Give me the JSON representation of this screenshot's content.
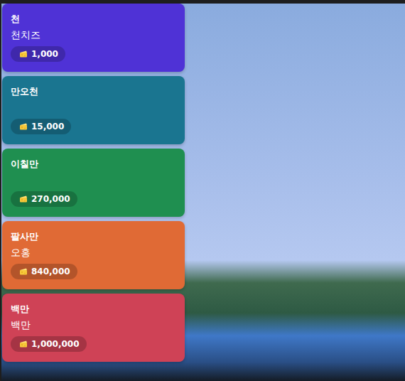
{
  "cards": [
    {
      "title": "천",
      "subtitle": "천치즈",
      "amount": "1,000",
      "color": "#4f32d6"
    },
    {
      "title": "만오천",
      "subtitle": "",
      "amount": "15,000",
      "color": "#1a7590"
    },
    {
      "title": "이칠만",
      "subtitle": "",
      "amount": "270,000",
      "color": "#1f8f50"
    },
    {
      "title": "팔사만",
      "subtitle": "오홍",
      "amount": "840,000",
      "color": "#e06a35"
    },
    {
      "title": "백만",
      "subtitle": "백만",
      "amount": "1,000,000",
      "color": "#cf4256"
    }
  ]
}
